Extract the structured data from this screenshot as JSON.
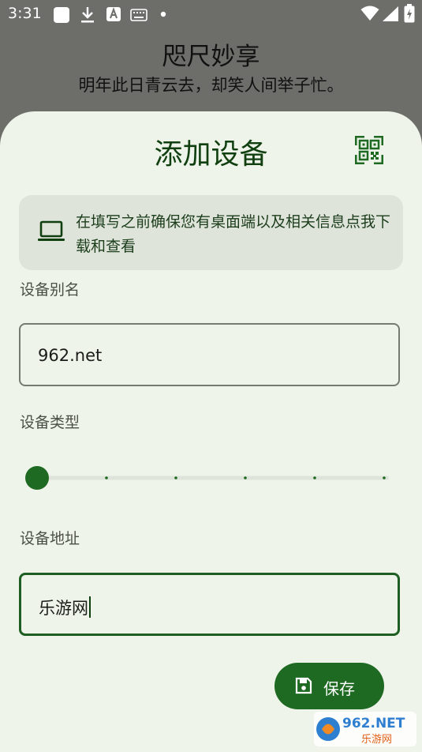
{
  "status_bar": {
    "time": "3:31"
  },
  "background": {
    "title": "咫尺妙享",
    "subtitle": "明年此日青云去，却笑人间举子忙。"
  },
  "sheet": {
    "title": "添加设备",
    "info_text": "在填写之前确保您有桌面端以及相关信息点我下载和查看",
    "alias_label": "设备别名",
    "alias_value": "962.net",
    "type_label": "设备类型",
    "type_slider": {
      "steps": 6,
      "selected_index": 0
    },
    "address_label": "设备地址",
    "address_value": "乐游网",
    "save_label": "保存"
  },
  "watermark": {
    "logo_text": "962.NET",
    "caption": "乐游网"
  },
  "colors": {
    "primary": "#1e6a22",
    "sheet_bg": "#eff4ea",
    "info_bg": "#dfe4da",
    "dim_bg": "#6d6e6a"
  },
  "icons": {
    "qr": "qr-scan-icon",
    "info": "laptop-icon",
    "save": "save-icon"
  }
}
